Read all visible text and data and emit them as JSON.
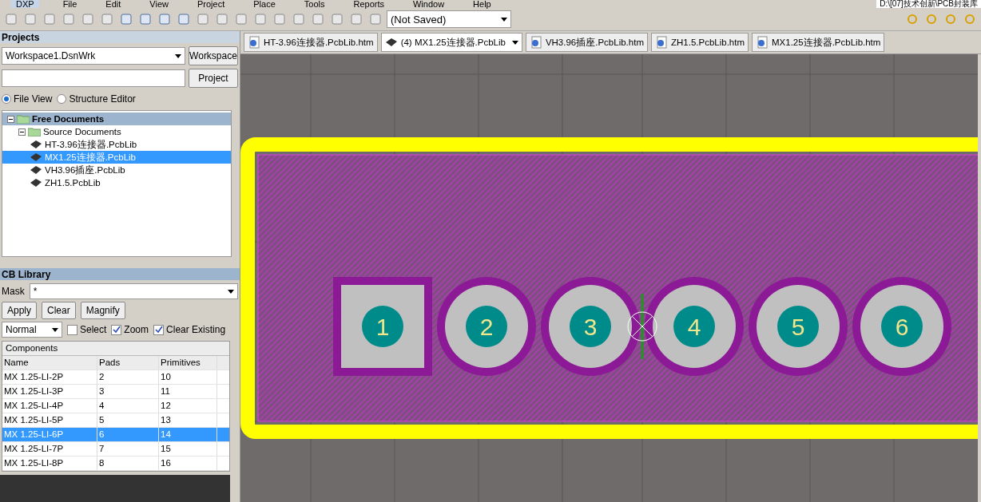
{
  "menu": [
    {
      "label": "DXP",
      "selected": true
    },
    {
      "label": "File",
      "selected": false
    },
    {
      "label": "Edit",
      "selected": false
    },
    {
      "label": "View",
      "selected": false
    },
    {
      "label": "Project",
      "selected": false
    },
    {
      "label": "Place",
      "selected": false
    },
    {
      "label": "Tools",
      "selected": false
    },
    {
      "label": "Reports",
      "selected": false
    },
    {
      "label": "Window",
      "selected": false
    },
    {
      "label": "Help",
      "selected": false
    }
  ],
  "path_text": "D:\\[07]技术创新\\PCB封装库",
  "view_config": "(Not Saved)",
  "doc_tabs": [
    {
      "label": "HT-3.96连接器.PcbLib.htm",
      "kind": "web",
      "selected": false
    },
    {
      "label": "(4) MX1.25连接器.PcbLib",
      "kind": "pcb",
      "selected": true
    },
    {
      "label": "VH3.96插座.PcbLib.htm",
      "kind": "web",
      "selected": false
    },
    {
      "label": "ZH1.5.PcbLib.htm",
      "kind": "web",
      "selected": false
    },
    {
      "label": "MX1.25连接器.PcbLib.htm",
      "kind": "web",
      "selected": false
    }
  ],
  "projects": {
    "title": "Projects",
    "workspace": "Workspace1.DsnWrk",
    "workspace_button": "Workspace",
    "project_button": "Project",
    "views": [
      {
        "label": "File View",
        "selected": true
      },
      {
        "label": "Structure Editor",
        "selected": false
      }
    ],
    "tree": [
      {
        "label": "Free Documents",
        "expanded": true,
        "selected": false,
        "children": [
          {
            "label": "Source Documents",
            "expanded": true,
            "selected": false,
            "children": [
              {
                "label": "HT-3.96连接器.PcbLib",
                "selected": false
              },
              {
                "label": "MX1.25连接器.PcbLib",
                "selected": true
              },
              {
                "label": "VH3.96插座.PcbLib",
                "selected": false
              },
              {
                "label": "ZH1.5.PcbLib",
                "selected": false
              }
            ]
          }
        ]
      }
    ]
  },
  "pcb_library": {
    "title": "CB Library",
    "mask_label": "Mask",
    "mask": "*",
    "buttons": [
      "Apply",
      "Clear",
      "Magnify"
    ],
    "mode": "Normal",
    "options": [
      {
        "label": "Select",
        "checked": false
      },
      {
        "label": "Zoom",
        "checked": true
      },
      {
        "label": "Clear Existing",
        "checked": true
      }
    ],
    "table_title": "Components",
    "columns": [
      "Name",
      "Pads",
      "Primitives"
    ],
    "rows": [
      {
        "cells": [
          "MX 1.25-LI-2P",
          "2",
          "10"
        ],
        "selected": false
      },
      {
        "cells": [
          "MX 1.25-LI-3P",
          "3",
          "11"
        ],
        "selected": false
      },
      {
        "cells": [
          "MX 1.25-LI-4P",
          "4",
          "12"
        ],
        "selected": false
      },
      {
        "cells": [
          "MX 1.25-LI-5P",
          "5",
          "13"
        ],
        "selected": false
      },
      {
        "cells": [
          "MX 1.25-LI-6P",
          "6",
          "14"
        ],
        "selected": true
      },
      {
        "cells": [
          "MX 1.25-LI-7P",
          "7",
          "15"
        ],
        "selected": false
      },
      {
        "cells": [
          "MX 1.25-LI-8P",
          "8",
          "16"
        ],
        "selected": false
      }
    ]
  },
  "pads": [
    {
      "label": "1",
      "kind": "square"
    },
    {
      "label": "2",
      "kind": "round"
    },
    {
      "label": "3",
      "kind": "round"
    },
    {
      "label": "4",
      "kind": "round"
    },
    {
      "label": "5",
      "kind": "round"
    },
    {
      "label": "6",
      "kind": "round"
    }
  ]
}
